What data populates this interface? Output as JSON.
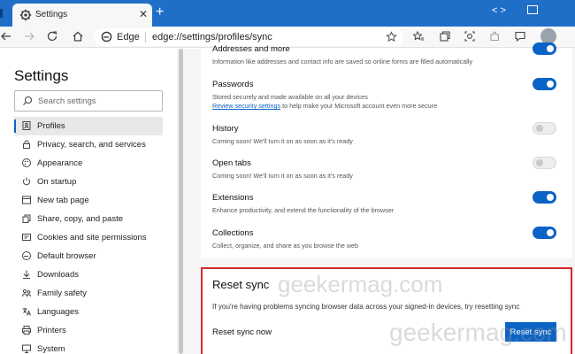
{
  "browser": {
    "tab_title": "Settings",
    "tab_close": "✕",
    "new_tab": "+",
    "title_controls": "< >",
    "address_label": "Edge",
    "url": "edge://settings/profiles/sync"
  },
  "sidebar": {
    "title": "Settings",
    "search_placeholder": "Search settings",
    "items": [
      {
        "label": "Profiles",
        "icon": "profile-icon",
        "active": true
      },
      {
        "label": "Privacy, search, and services",
        "icon": "lock-icon"
      },
      {
        "label": "Appearance",
        "icon": "appearance-icon"
      },
      {
        "label": "On startup",
        "icon": "power-icon"
      },
      {
        "label": "New tab page",
        "icon": "new-tab-icon"
      },
      {
        "label": "Share, copy, and paste",
        "icon": "share-icon"
      },
      {
        "label": "Cookies and site permissions",
        "icon": "cookies-icon"
      },
      {
        "label": "Default browser",
        "icon": "browser-icon"
      },
      {
        "label": "Downloads",
        "icon": "download-icon"
      },
      {
        "label": "Family safety",
        "icon": "family-icon"
      },
      {
        "label": "Languages",
        "icon": "languages-icon"
      },
      {
        "label": "Printers",
        "icon": "printer-icon"
      },
      {
        "label": "System",
        "icon": "system-icon"
      }
    ]
  },
  "sync_items": [
    {
      "title": "Addresses and more",
      "desc": "Information like addresses and contact info are saved so online forms are filled automatically",
      "on": true
    },
    {
      "title": "Passwords",
      "desc": "Stored securely and made available on all your devices",
      "link": "Review security settings",
      "link_suffix": " to help make your Microsoft account even more secure",
      "on": true
    },
    {
      "title": "History",
      "desc": "Coming soon! We'll turn it on as soon as it's ready",
      "on": false
    },
    {
      "title": "Open tabs",
      "desc": "Coming soon! We'll turn it on as soon as it's ready",
      "on": false
    },
    {
      "title": "Extensions",
      "desc": "Enhance productivity, and extend the functionality of the browser",
      "on": true
    },
    {
      "title": "Collections",
      "desc": "Collect, organize, and share as you browse the web",
      "on": true
    }
  ],
  "reset": {
    "title": "Reset sync",
    "desc": "If you're having problems syncing browser data across your signed-in devices, try resetting sync",
    "row_label": "Reset sync now",
    "button": "Reset sync"
  },
  "watermark": "geekermag.com",
  "colors": {
    "accent": "#0a63c5",
    "titlebar": "#1f6fc9",
    "highlight_border": "#d32a2a"
  }
}
